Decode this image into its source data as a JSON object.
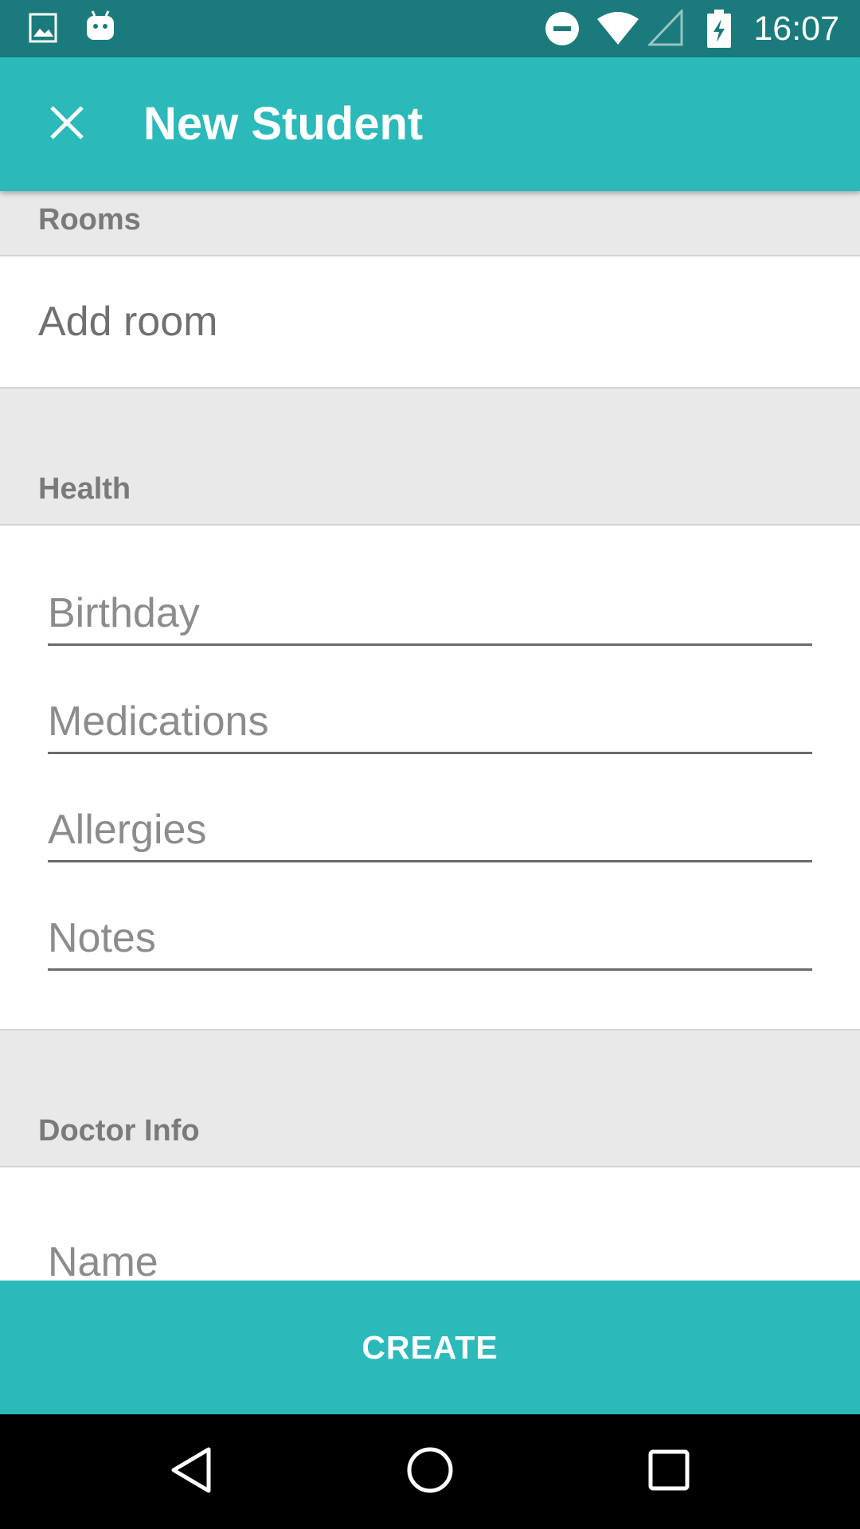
{
  "status_bar": {
    "time": "16:07",
    "icons": [
      "image-icon",
      "android-icon",
      "do-not-disturb-icon",
      "wifi-icon",
      "cell-signal-icon",
      "battery-charging-icon"
    ]
  },
  "app_bar": {
    "title": "New Student",
    "close_icon": "close-icon"
  },
  "sections": {
    "rooms": {
      "header": "Rooms",
      "add_room": "Add room"
    },
    "health": {
      "header": "Health",
      "fields": {
        "birthday": {
          "placeholder": "Birthday",
          "value": ""
        },
        "medications": {
          "placeholder": "Medications",
          "value": ""
        },
        "allergies": {
          "placeholder": "Allergies",
          "value": ""
        },
        "notes": {
          "placeholder": "Notes",
          "value": ""
        }
      }
    },
    "doctor_info": {
      "header": "Doctor Info",
      "fields": {
        "name": {
          "placeholder": "Name",
          "value": ""
        }
      }
    }
  },
  "create_button": {
    "label": "CREATE"
  },
  "nav_bar": {
    "icons": [
      "back-icon",
      "home-icon",
      "recents-icon"
    ]
  },
  "colors": {
    "status_bar": "#1b7b7c",
    "primary": "#2bb9ba",
    "section_bg": "#e9e9e9",
    "section_text": "#7a7a7a",
    "hint_text": "#8c8c8c",
    "nav_bar": "#000000"
  }
}
